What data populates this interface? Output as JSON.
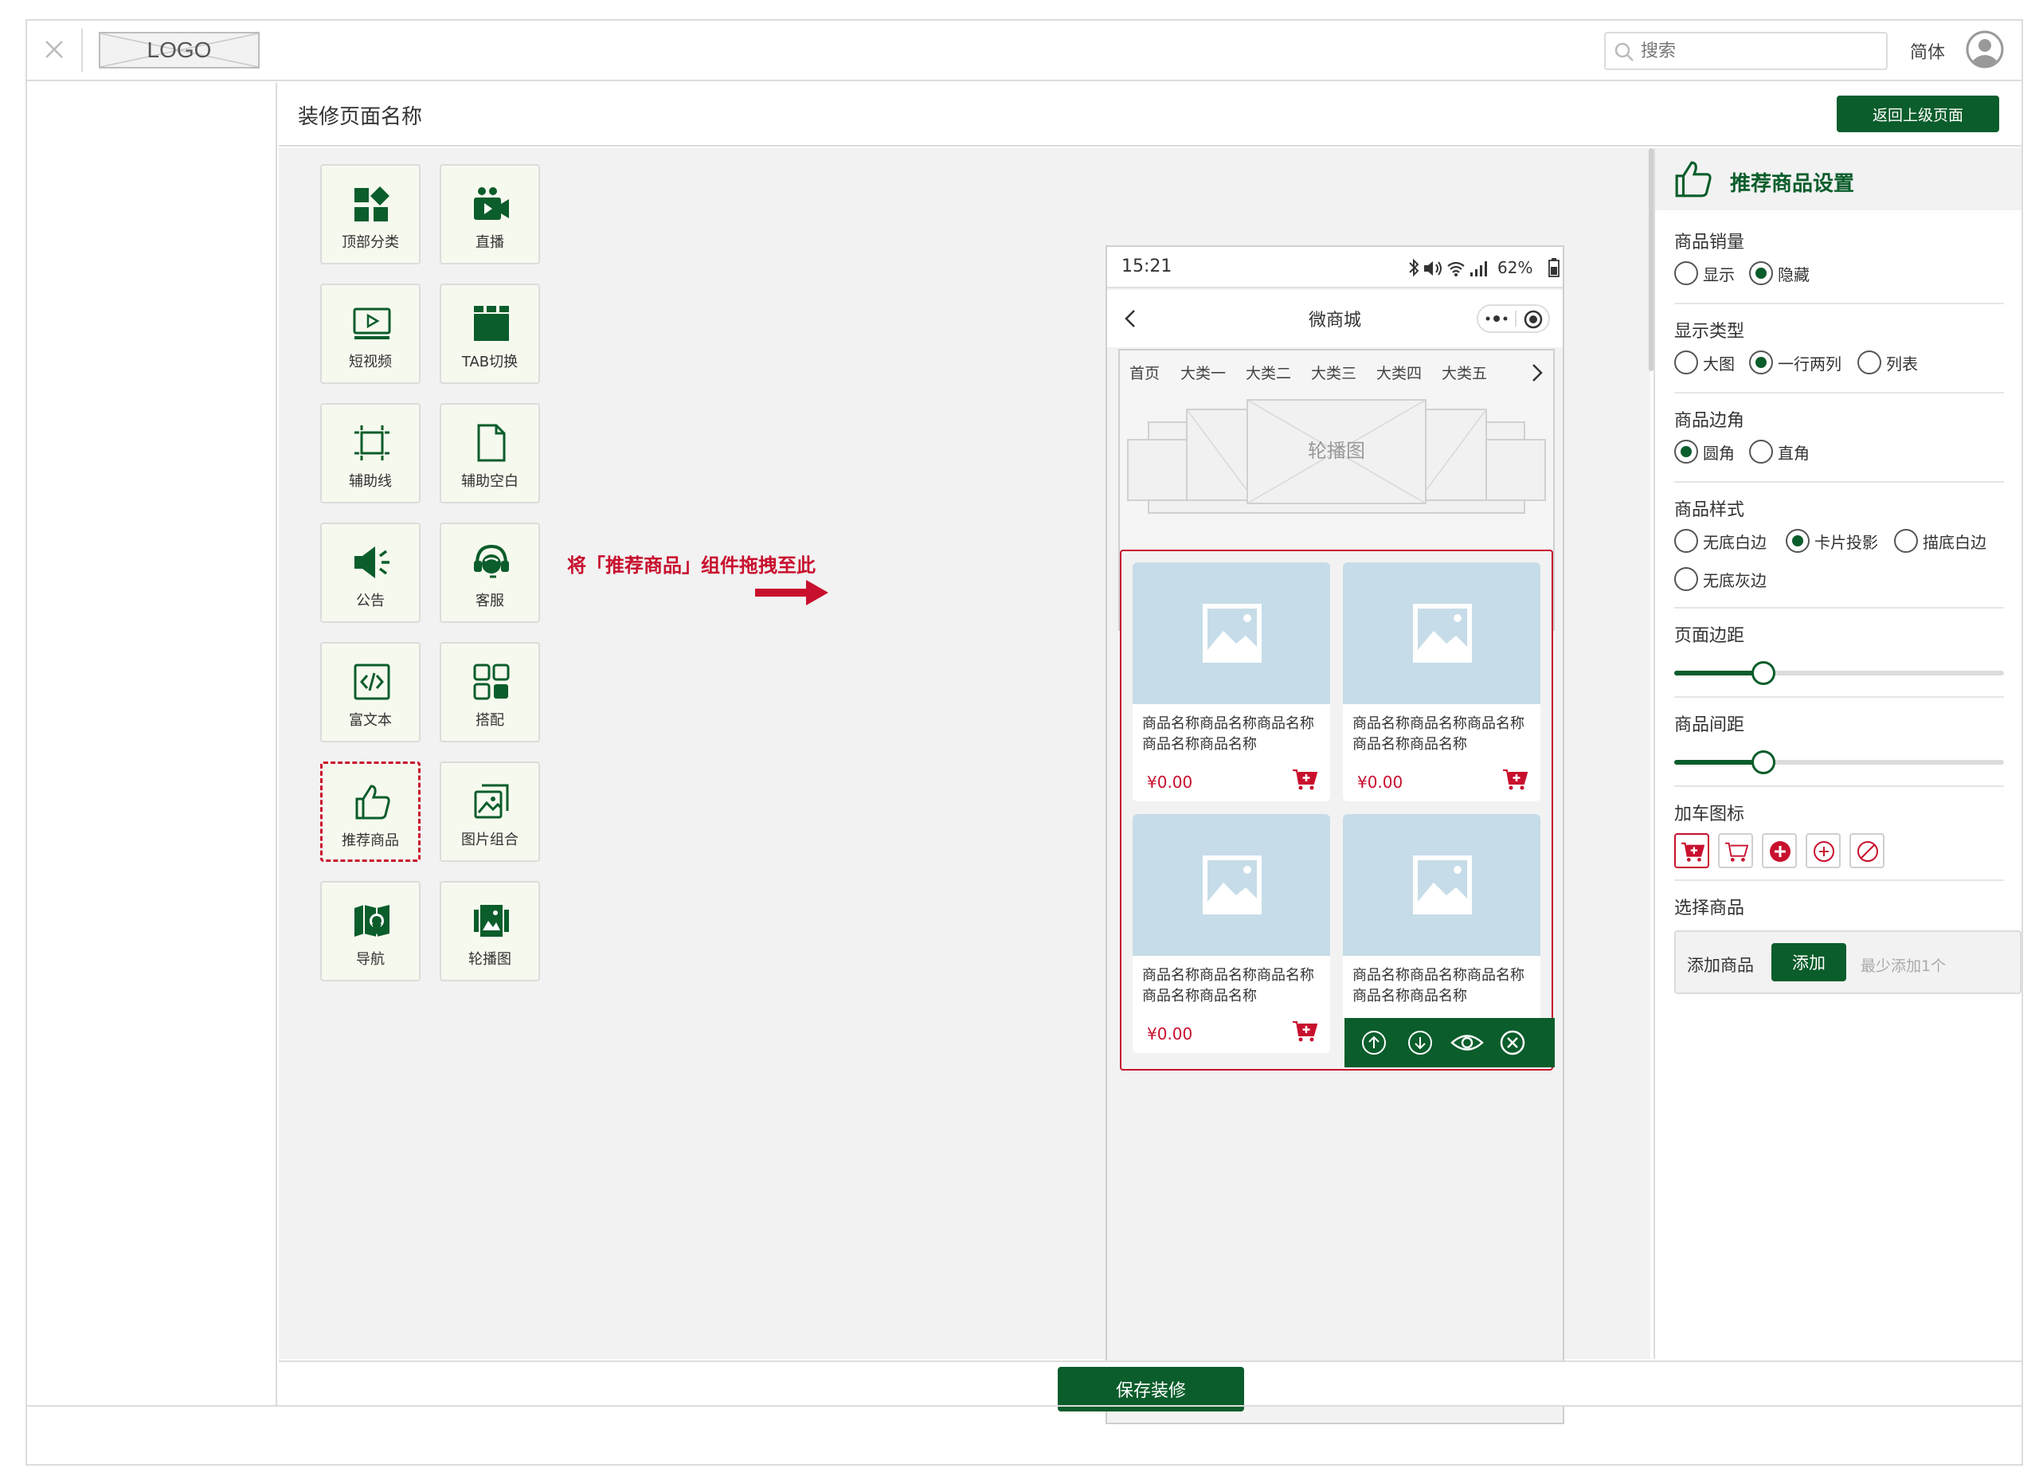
{
  "app": {
    "logo": "LOGO"
  },
  "header": {
    "search_placeholder": "搜索",
    "lang": "简体"
  },
  "page": {
    "title": "装修页面名称",
    "back_label": "返回上级页面",
    "save_label": "保存装修"
  },
  "palette": {
    "items": [
      {
        "label": "顶部分类",
        "icon": "category-icon"
      },
      {
        "label": "直播",
        "icon": "live-camera-icon"
      },
      {
        "label": "短视频",
        "icon": "short-video-icon"
      },
      {
        "label": "TAB切换",
        "icon": "tab-switch-icon"
      },
      {
        "label": "辅助线",
        "icon": "guide-line-icon"
      },
      {
        "label": "辅助空白",
        "icon": "blank-page-icon"
      },
      {
        "label": "公告",
        "icon": "announcement-icon"
      },
      {
        "label": "客服",
        "icon": "customer-service-icon"
      },
      {
        "label": "富文本",
        "icon": "rich-text-icon"
      },
      {
        "label": "搭配",
        "icon": "combo-grid-icon"
      },
      {
        "label": "推荐商品",
        "icon": "thumbs-up-icon",
        "selected": true
      },
      {
        "label": "图片组合",
        "icon": "image-group-icon"
      },
      {
        "label": "导航",
        "icon": "map-navigation-icon"
      },
      {
        "label": "轮播图",
        "icon": "carousel-icon"
      }
    ],
    "hint": "将「推荐商品」组件拖拽至此"
  },
  "phone": {
    "time": "15:21",
    "battery": "62%",
    "nav_title": "微商城",
    "categories": [
      "首页",
      "大类一",
      "大类二",
      "大类三",
      "大类四",
      "大类五"
    ],
    "banner_label": "轮播图",
    "products": [
      {
        "name": "商品名称商品名称商品名称商品名称商品名称",
        "price": "¥0.00"
      },
      {
        "name": "商品名称商品名称商品名称商品名称商品名称",
        "price": "¥0.00"
      },
      {
        "name": "商品名称商品名称商品名称商品名称商品名称",
        "price": "¥0.00"
      },
      {
        "name": "商品名称商品名称商品名称商品名称商品名称",
        "price": ""
      }
    ]
  },
  "settings": {
    "title": "推荐商品设置",
    "sales": {
      "label": "商品销量",
      "options": [
        "显示",
        "隐藏"
      ],
      "selected": "隐藏"
    },
    "display_type": {
      "label": "显示类型",
      "options": [
        "大图",
        "一行两列",
        "列表"
      ],
      "selected": "一行两列"
    },
    "corner": {
      "label": "商品边角",
      "options": [
        "圆角",
        "直角"
      ],
      "selected": "圆角"
    },
    "style": {
      "label": "商品样式",
      "options": [
        "无底白边",
        "卡片投影",
        "描底白边",
        "无底灰边"
      ],
      "selected": "卡片投影"
    },
    "page_margin": {
      "label": "页面边距",
      "value": 0.27
    },
    "item_spacing": {
      "label": "商品间距",
      "value": 0.27
    },
    "cart_icon": {
      "label": "加车图标",
      "options": [
        "cart-filled-icon",
        "cart-outline-icon",
        "plus-filled-icon",
        "plus-outline-icon",
        "ban-icon"
      ],
      "selected_index": 0
    },
    "select_goods": {
      "label": "选择商品",
      "add_label": "添加商品",
      "add_button": "添加",
      "hint": "最少添加1个"
    }
  },
  "colors": {
    "brand": "#0b5d2b",
    "accent": "#c8102e",
    "image_placeholder": "#c6dce8"
  }
}
